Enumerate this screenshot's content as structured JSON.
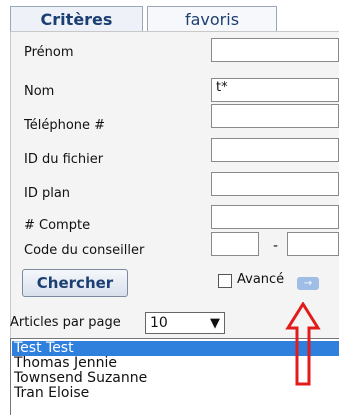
{
  "tabs": {
    "criteria_label": "Critères",
    "favorites_label": "favoris"
  },
  "form": {
    "fields": [
      {
        "label": "Prénom",
        "value": ""
      },
      {
        "label": "Nom",
        "value": "t*"
      },
      {
        "label": "Téléphone #",
        "value": ""
      },
      {
        "label": "ID du fichier",
        "value": ""
      },
      {
        "label": "ID plan",
        "value": ""
      },
      {
        "label": "# Compte",
        "value": ""
      }
    ],
    "advisor_code_label": "Code du conseiller",
    "advisor_code_separator": "-"
  },
  "actions": {
    "search_label": "Chercher",
    "advanced_label": "Avancé",
    "advanced_icon": "arrow-right-icon"
  },
  "paging": {
    "items_per_page_label": "Articles par page",
    "items_per_page_value": "10"
  },
  "results": [
    {
      "name": "Test Test",
      "selected": true
    },
    {
      "name": "Thomas Jennie",
      "selected": false
    },
    {
      "name": "Townsend Suzanne",
      "selected": false
    },
    {
      "name": "Tran Eloise",
      "selected": false
    }
  ],
  "colors": {
    "accent": "#1b3f73",
    "selection": "#2f7fdc",
    "annotation_arrow": "#e21b1b"
  }
}
